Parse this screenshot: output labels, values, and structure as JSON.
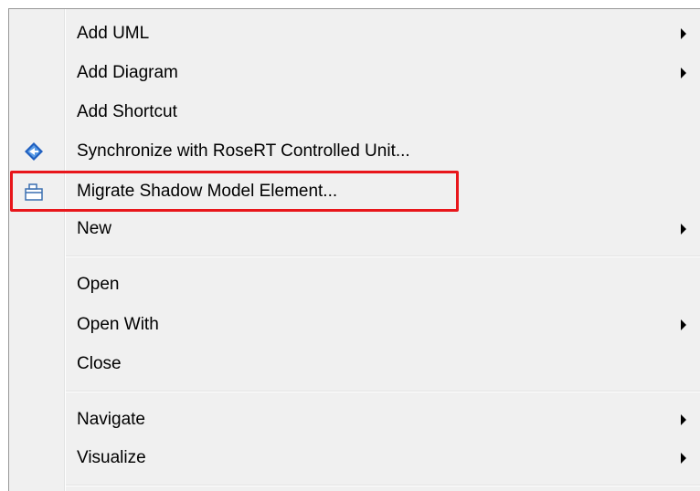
{
  "menu": {
    "items": [
      {
        "label": "Add UML",
        "submenu": true
      },
      {
        "label": "Add Diagram",
        "submenu": true
      },
      {
        "label": "Add Shortcut",
        "submenu": false
      },
      {
        "label": "Synchronize with RoseRT Controlled Unit...",
        "submenu": false,
        "icon": "sync-diamond-icon"
      },
      {
        "label": "Migrate Shadow Model Element...",
        "submenu": false,
        "icon": "migrate-folder-icon",
        "highlighted": true
      },
      {
        "label": "New",
        "submenu": true
      },
      {
        "label": "Open",
        "submenu": false
      },
      {
        "label": "Open With",
        "submenu": true
      },
      {
        "label": "Close",
        "submenu": false
      },
      {
        "label": "Navigate",
        "submenu": true
      },
      {
        "label": "Visualize",
        "submenu": true
      }
    ]
  },
  "colors": {
    "menu_background": "#f0f0f0",
    "highlight_border": "#e8161b",
    "icon_blue": "#1f5fbf"
  }
}
